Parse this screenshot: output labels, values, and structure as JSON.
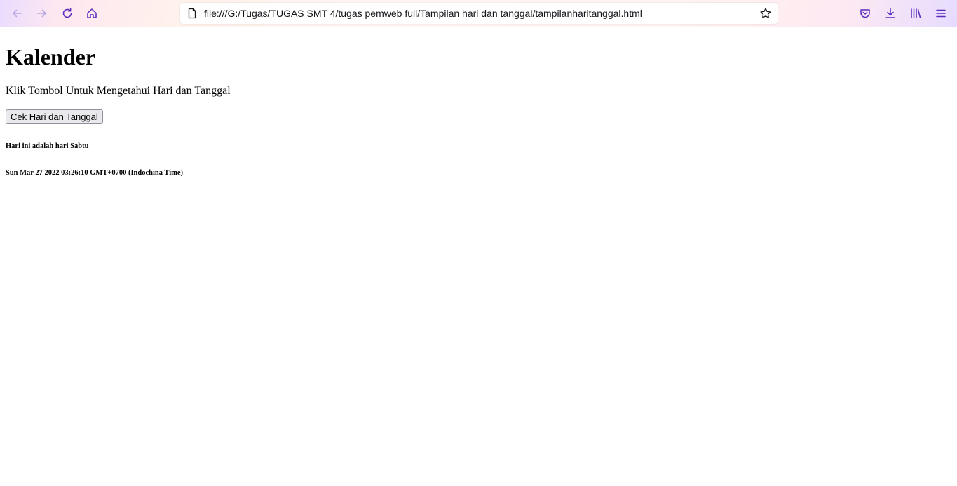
{
  "browser": {
    "url": "file:///G:/Tugas/TUGAS SMT 4/tugas pemweb full/Tampilan hari dan tanggal/tampilanharitanggal.html",
    "icons": {
      "back": "back-arrow-icon",
      "forward": "forward-arrow-icon",
      "reload": "reload-icon",
      "home": "home-icon",
      "page": "document-icon",
      "bookmark": "star-icon",
      "pocket": "pocket-icon",
      "downloads": "download-icon",
      "library": "library-icon",
      "menu": "hamburger-menu-icon"
    },
    "colors": {
      "icon": "#5b2bbd",
      "icon_disabled": "#b8a6e0"
    }
  },
  "page": {
    "title": "Kalender",
    "instruction": "Klik Tombol Untuk Mengetahui Hari dan Tanggal",
    "button_label": "Cek Hari dan Tanggal",
    "day_result": "Hari ini adalah hari Sabtu",
    "date_result": "Sun Mar 27 2022 03:26:10 GMT+0700 (Indochina Time)"
  }
}
